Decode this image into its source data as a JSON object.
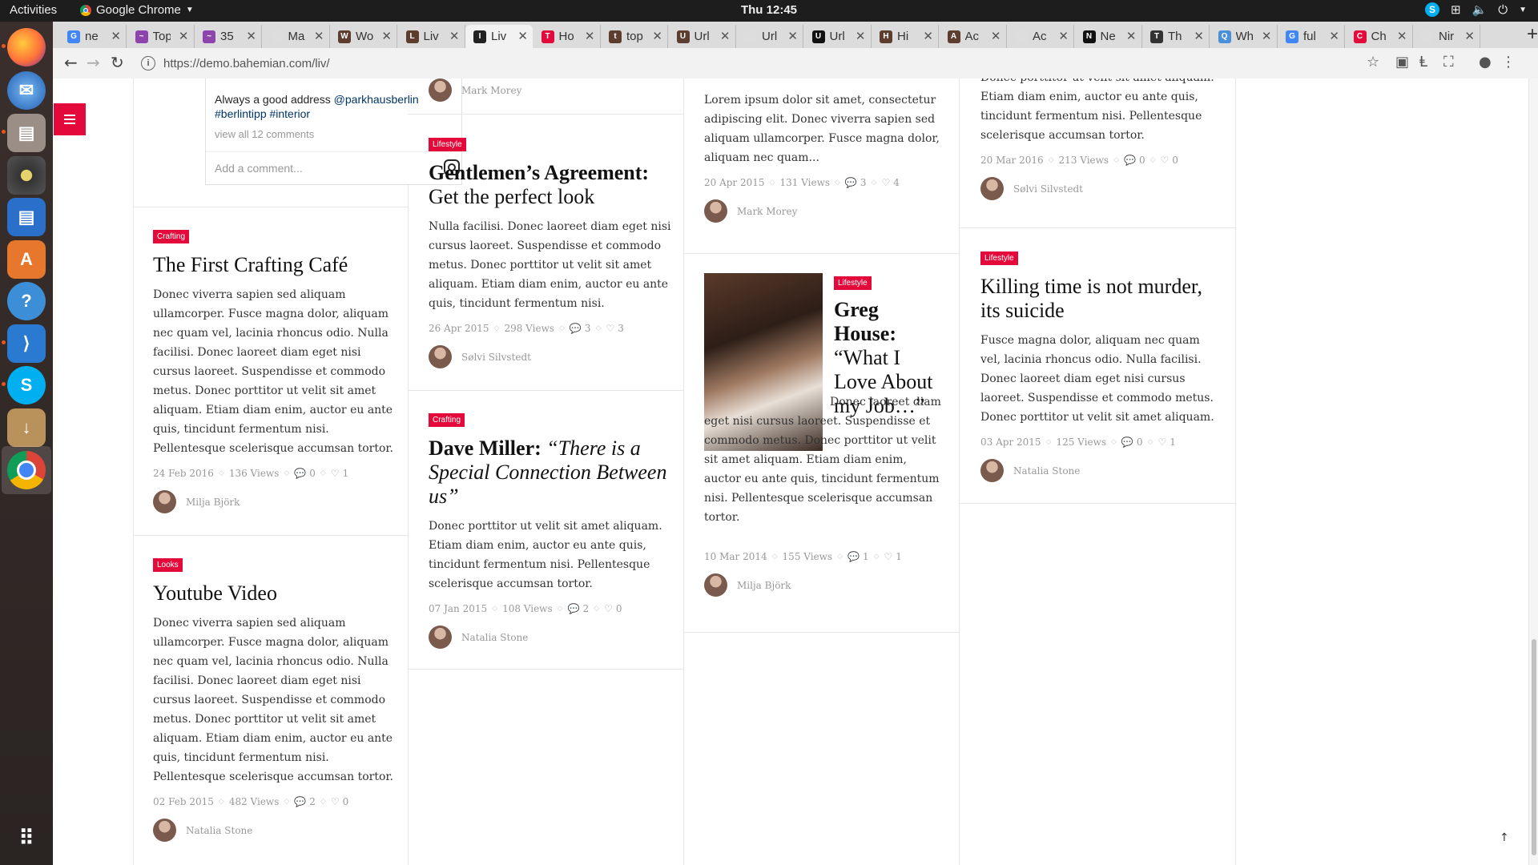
{
  "topbar": {
    "activities": "Activities",
    "app": "Google Chrome",
    "clock": "Thu 12:45"
  },
  "tabs": [
    {
      "title": "ne",
      "fav": "G",
      "color": "#4285f4"
    },
    {
      "title": "Top",
      "fav": "~",
      "color": "#8e44ad"
    },
    {
      "title": "35",
      "fav": "~",
      "color": "#8e44ad"
    },
    {
      "title": "Ma",
      "fav": "",
      "color": "#ddd"
    },
    {
      "title": "Wo",
      "fav": "W",
      "color": "#5c3d2e"
    },
    {
      "title": "Liv",
      "fav": "L",
      "color": "#5c3d2e"
    },
    {
      "title": "Liv",
      "fav": "I",
      "color": "#222"
    },
    {
      "title": "Ho",
      "fav": "T",
      "color": "#e4093b"
    },
    {
      "title": "top",
      "fav": "t",
      "color": "#5c3d2e"
    },
    {
      "title": "Url",
      "fav": "U",
      "color": "#5c3d2e"
    },
    {
      "title": "Url",
      "fav": "",
      "color": "#ddd"
    },
    {
      "title": "Url",
      "fav": "U",
      "color": "#111"
    },
    {
      "title": "Hi",
      "fav": "H",
      "color": "#5c3d2e"
    },
    {
      "title": "Ac",
      "fav": "A",
      "color": "#5c3d2e"
    },
    {
      "title": "Ac",
      "fav": "",
      "color": "#ddd"
    },
    {
      "title": "Ne",
      "fav": "N",
      "color": "#111"
    },
    {
      "title": "Th",
      "fav": "T",
      "color": "#333"
    },
    {
      "title": "Wh",
      "fav": "Q",
      "color": "#4a90d9"
    },
    {
      "title": "ful",
      "fav": "G",
      "color": "#4285f4"
    },
    {
      "title": "Ch",
      "fav": "C",
      "color": "#e4093b"
    },
    {
      "title": "Nir",
      "fav": "",
      "color": "#ddd"
    }
  ],
  "address": {
    "url": "https://demo.bahemian.com/liv/"
  },
  "instagram": {
    "comment": "Always a good address",
    "mention": "@parkhausberlin",
    "hashtags": "#berlintipp #interior",
    "view_all": "view all 12 comments",
    "placeholder": "Add a comment..."
  },
  "columns": {
    "col1": [
      {
        "tag": "Crafting",
        "title": "The First Crafting Café",
        "excerpt": "Donec viverra sapien sed aliquam ullamcorper. Fusce magna dolor, aliquam nec quam vel, lacinia rhoncus odio. Nulla facilisi. Donec laoreet diam eget nisi cursus laoreet. Suspendisse et commodo metus. Donec porttitor ut velit sit amet aliquam. Etiam diam enim, auctor eu ante quis, tincidunt fermentum nisi. Pellentesque scelerisque accumsan tortor.",
        "date": "24 Feb 2016",
        "views": "136 Views",
        "comments": "0",
        "likes": "1",
        "author": "Milja Björk"
      },
      {
        "tag": "Looks",
        "title": "Youtube Video",
        "excerpt": "Donec viverra sapien sed aliquam ullamcorper. Fusce magna dolor, aliquam nec quam vel, lacinia rhoncus odio. Nulla facilisi. Donec laoreet diam eget nisi cursus laoreet. Suspendisse et commodo metus. Donec porttitor ut velit sit amet aliquam. Etiam diam enim, auctor eu ante quis, tincidunt fermentum nisi. Pellentesque scelerisque accumsan tortor.",
        "date": "02 Feb 2015",
        "views": "482 Views",
        "comments": "2",
        "likes": "0",
        "author": "Natalia Stone"
      }
    ],
    "col2": [
      {
        "author_top": "Mark Morey"
      },
      {
        "tag": "Lifestyle",
        "title_bold": "Gentlemen’s Agreement:",
        "title_rest": "Get the perfect look",
        "excerpt": "Nulla facilisi. Donec laoreet diam eget nisi cursus laoreet. Suspendisse et commodo metus. Donec porttitor ut velit sit amet aliquam. Etiam diam enim, auctor eu ante quis, tincidunt fermentum nisi.",
        "date": "26 Apr 2015",
        "views": "298 Views",
        "comments": "3",
        "likes": "3",
        "author": "Sølvi Silvstedt"
      },
      {
        "tag": "Crafting",
        "title_bold": "Dave Miller:",
        "title_italic": "“There is a Special Connection Between us”",
        "excerpt": "Donec porttitor ut velit sit amet aliquam. Etiam diam enim, auctor eu ante quis, tincidunt fermentum nisi. Pellentesque scelerisque accumsan tortor.",
        "date": "07 Jan 2015",
        "views": "108 Views",
        "comments": "2",
        "likes": "0",
        "author": "Natalia Stone"
      }
    ],
    "col3": [
      {
        "excerpt": "Lorem ipsum dolor sit amet, consectetur adipiscing elit. Donec viverra sapien sed aliquam ullamcorper. Fusce magna dolor, aliquam nec quam...",
        "date": "20 Apr 2015",
        "views": "131 Views",
        "comments": "3",
        "likes": "4",
        "author": "Mark Morey"
      },
      {
        "tag": "Lifestyle",
        "title_bold": "Greg House:",
        "title_rest": "“What I Love About my Job…”",
        "excerpt": "Donec laoreet diam eget nisi cursus laoreet. Suspendisse et commodo metus. Donec porttitor ut velit sit amet aliquam. Etiam diam enim, auctor eu ante quis, tincidunt fermentum nisi. Pellentesque scelerisque accumsan tortor.",
        "date": "10 Mar 2014",
        "views": "155 Views",
        "comments": "1",
        "likes": "1",
        "author": "Milja Björk"
      }
    ],
    "col4": [
      {
        "excerpt": "Donec porttitor ut velit sit amet aliquam. Etiam diam enim, auctor eu ante quis, tincidunt fermentum nisi. Pellentesque scelerisque accumsan tortor.",
        "date": "20 Mar 2016",
        "views": "213 Views",
        "comments": "0",
        "likes": "0",
        "author": "Sølvi Silvstedt"
      },
      {
        "tag": "Lifestyle",
        "title": "Killing time is not murder, its suicide",
        "excerpt": "Fusce magna dolor, aliquam nec quam vel, lacinia rhoncus odio. Nulla facilisi. Donec laoreet diam eget nisi cursus laoreet. Suspendisse et commodo metus. Donec porttitor ut velit sit amet aliquam.",
        "date": "03 Apr 2015",
        "views": "125 Views",
        "comments": "0",
        "likes": "1",
        "author": "Natalia Stone"
      }
    ]
  },
  "colors": {
    "accent": "#e4093b"
  }
}
